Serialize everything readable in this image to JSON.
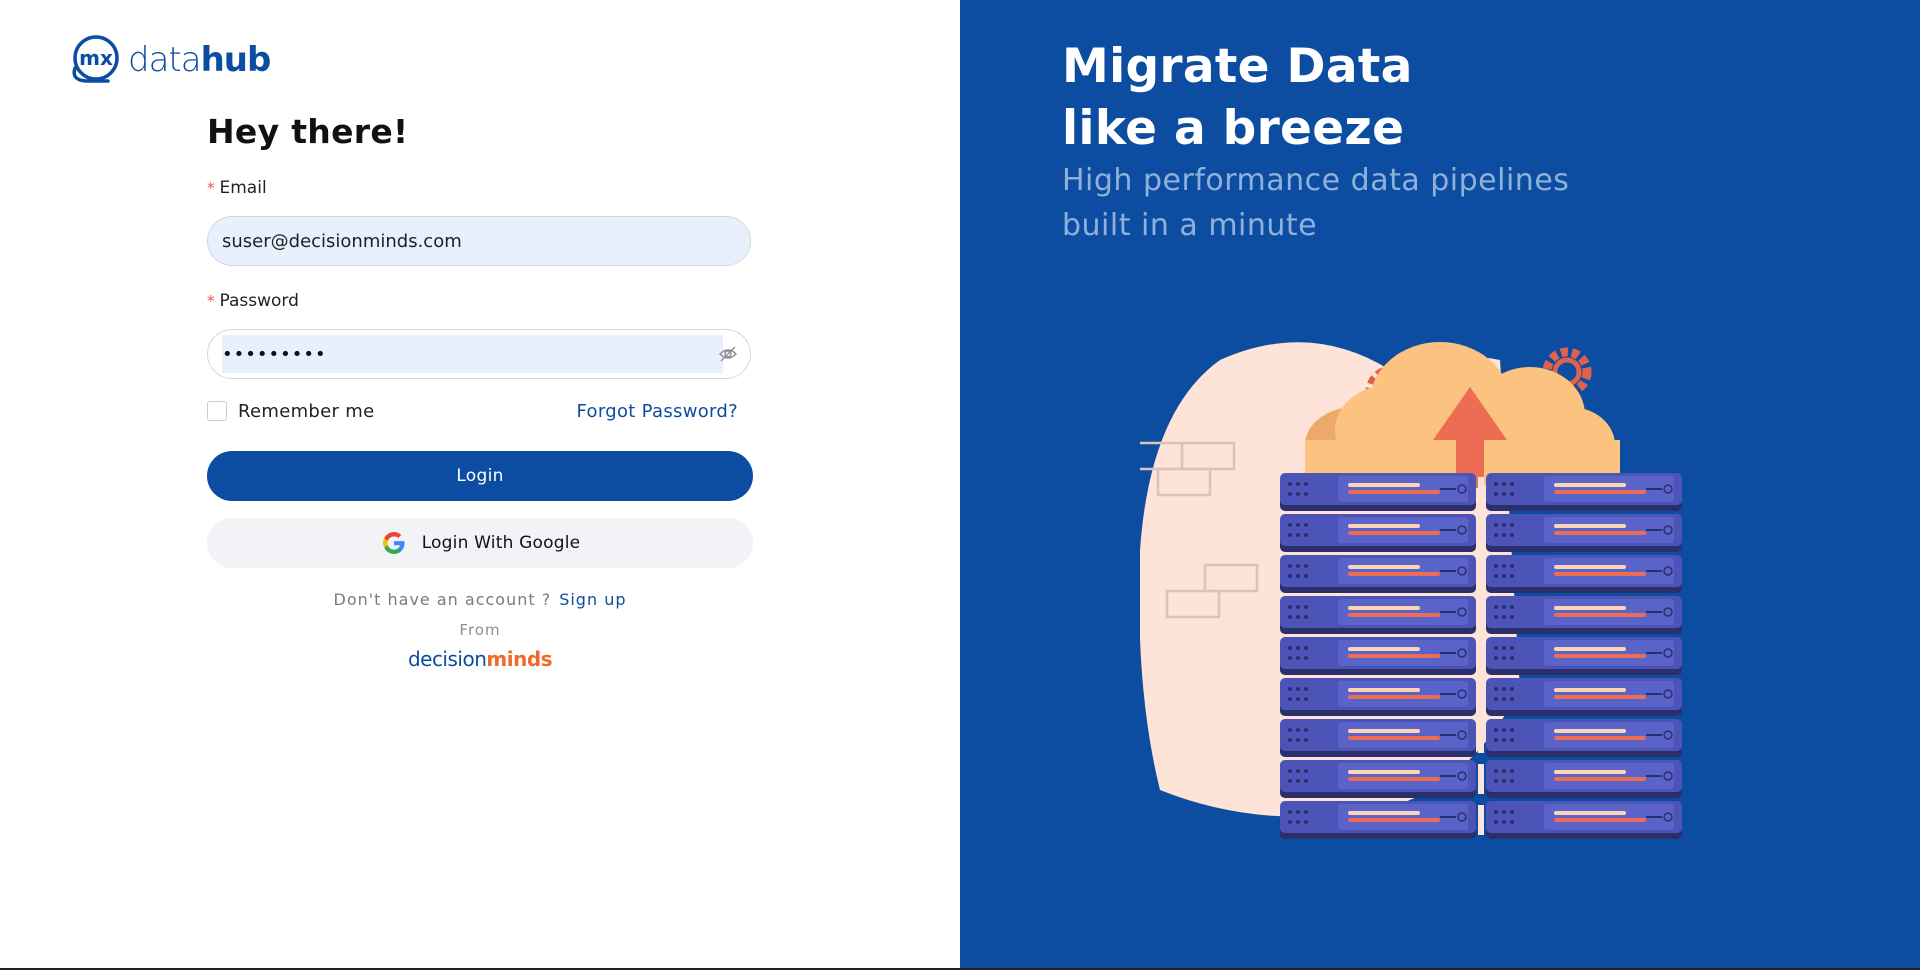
{
  "brand": {
    "logo_mark": "mx",
    "logo_text_light": "data",
    "logo_text_bold": "hub"
  },
  "login_form": {
    "heading": "Hey there!",
    "email": {
      "label": "Email",
      "required_marker": "*",
      "value": "suser@decisionminds.com"
    },
    "password": {
      "label": "Password",
      "required_marker": "*",
      "value": "•••••••••",
      "toggle_icon": "eye-slash-icon"
    },
    "remember_me": {
      "label": "Remember me",
      "checked": false
    },
    "forgot_password": "Forgot Password?",
    "login_button": "Login",
    "google_button": "Login With Google",
    "no_account_text": "Don't have an account ?",
    "sign_up_link": "Sign up",
    "from_label": "From",
    "company_light": "decision",
    "company_bold": "minds"
  },
  "hero": {
    "title_line1": "Migrate Data",
    "title_line2": "like a breeze",
    "subtitle_line1": "High performance data pipelines",
    "subtitle_line2": "built in a minute",
    "illustration_icon": "server-rack-cloud-upload-illustration"
  },
  "colors": {
    "primary": "#0d4da1",
    "accent": "#f06a2a",
    "input_fill": "#e8f0fe",
    "required": "#ff4d4f"
  }
}
